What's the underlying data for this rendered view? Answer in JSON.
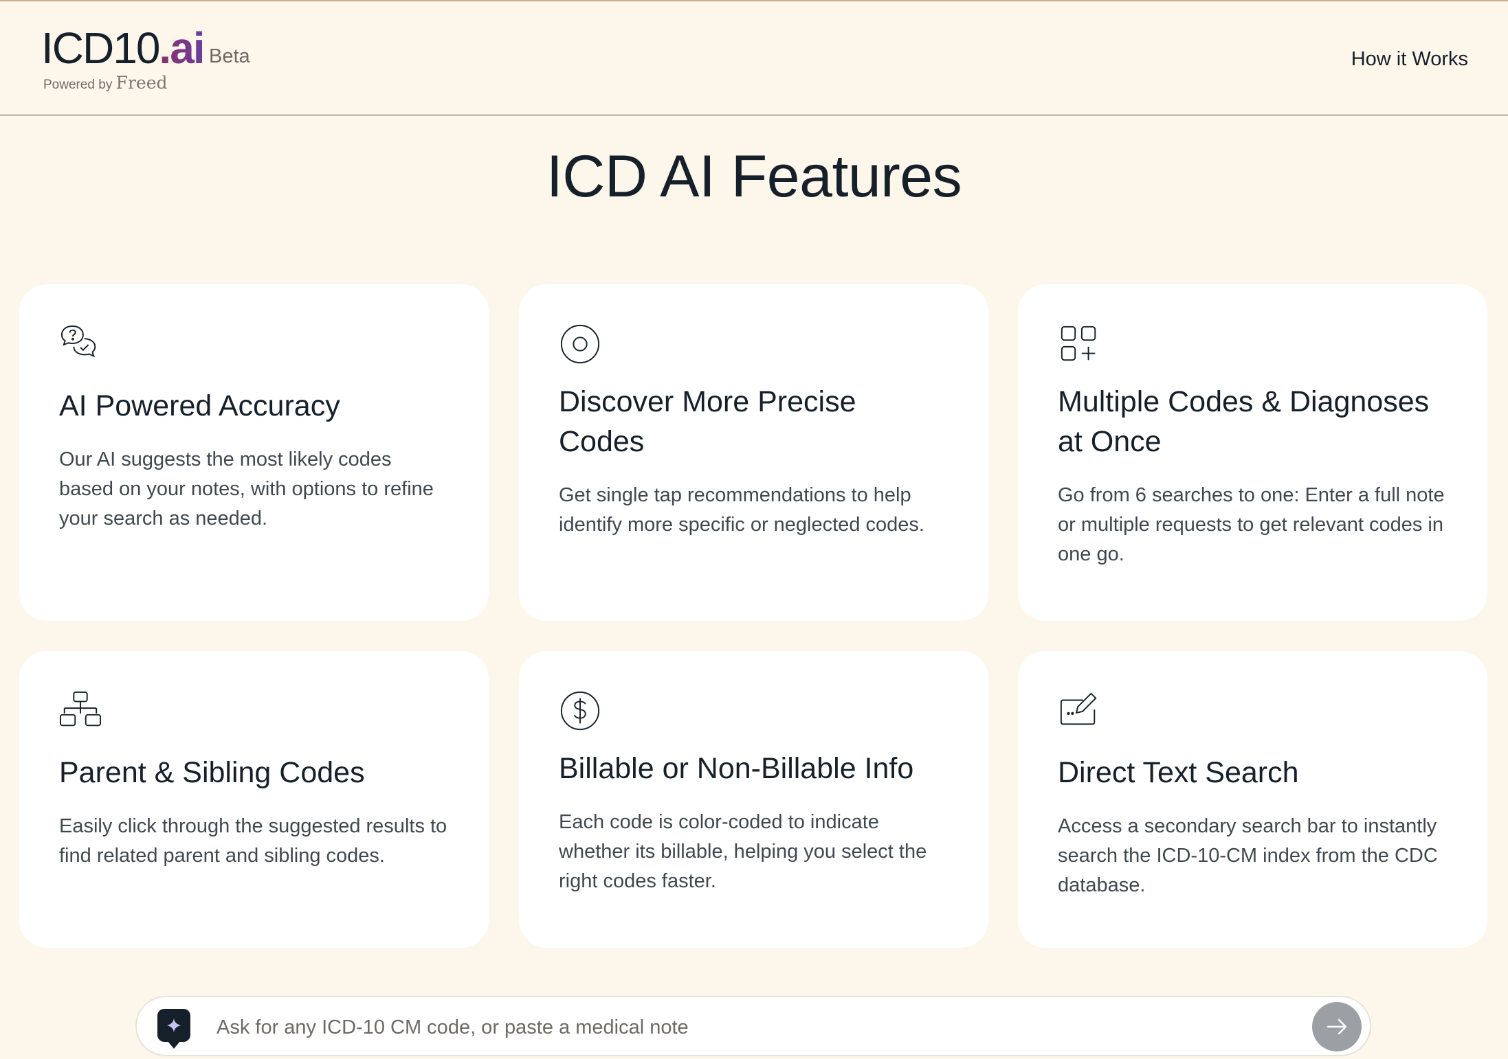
{
  "header": {
    "logo_text": "ICD10",
    "logo_accent": ".ai",
    "powered_by": "Powered by",
    "brand": "Freed",
    "beta": "Beta",
    "nav_link": "How it Works"
  },
  "page": {
    "title": "ICD AI Features"
  },
  "cards": [
    {
      "icon": "chat-question-check-icon",
      "title": "AI Powered Accuracy",
      "text": "Our AI suggests the most likely codes based on your notes, with options to refine your search as needed."
    },
    {
      "icon": "target-icon",
      "title": "Discover More Precise Codes",
      "text": "Get single tap recommendations to help identify more specific or neglected codes."
    },
    {
      "icon": "grid-plus-icon",
      "title": "Multiple Codes & Diagnoses at Once",
      "text": "Go from 6 searches to one: Enter a full note or multiple requests to get relevant codes in one go."
    },
    {
      "icon": "hierarchy-icon",
      "title": "Parent & Sibling Codes",
      "text": "Easily click through the suggested results to find related parent and sibling codes."
    },
    {
      "icon": "dollar-circle-icon",
      "title": "Billable or Non-Billable Info",
      "text": "Each code is color-coded to indicate whether its billable, helping you select the right codes faster."
    },
    {
      "icon": "edit-field-icon",
      "title": "Direct Text Search",
      "text": "Access a secondary search bar to instantly search the ICD-10-CM index from the CDC database."
    }
  ],
  "search": {
    "placeholder": "Ask for any ICD-10 CM code, or paste a medical note",
    "value": ""
  },
  "colors": {
    "background": "#fdf6ea",
    "card": "#ffffff",
    "text": "#16202a",
    "muted": "#40484f",
    "accent_gradient_start": "#8c2f6a",
    "accent_gradient_end": "#6a3fa0",
    "send_button": "#9aa0a4"
  }
}
